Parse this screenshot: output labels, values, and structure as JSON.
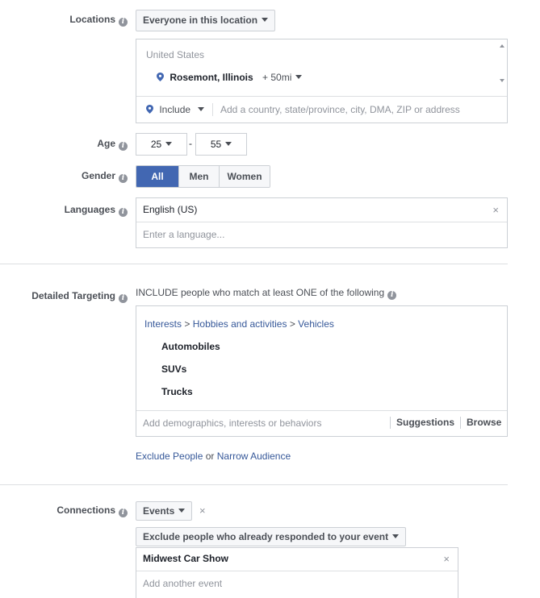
{
  "locations": {
    "label": "Locations",
    "mode_button": "Everyone in this location",
    "country": "United States",
    "city": "Rosemont, Illinois",
    "radius": "+ 50mi",
    "include_label": "Include",
    "placeholder": "Add a country, state/province, city, DMA, ZIP or address"
  },
  "age": {
    "label": "Age",
    "min": "25",
    "separator": "-",
    "max": "55"
  },
  "gender": {
    "label": "Gender",
    "options": [
      "All",
      "Men",
      "Women"
    ],
    "selected": "All"
  },
  "languages": {
    "label": "Languages",
    "selected": "English (US)",
    "placeholder": "Enter a language..."
  },
  "detailed_targeting": {
    "label": "Detailed Targeting",
    "instruction": "INCLUDE people who match at least ONE of the following",
    "breadcrumb": [
      "Interests",
      "Hobbies and activities",
      "Vehicles"
    ],
    "breadcrumb_sep": ">",
    "items": [
      "Automobiles",
      "SUVs",
      "Trucks"
    ],
    "placeholder": "Add demographics, interests or behaviors",
    "suggestions": "Suggestions",
    "browse": "Browse",
    "exclude_link": "Exclude People",
    "or_text": "or",
    "narrow_link": "Narrow Audience"
  },
  "connections": {
    "label": "Connections",
    "type_button": "Events",
    "exclude_dropdown": "Exclude people who already responded to your event",
    "event": "Midwest Car Show",
    "placeholder": "Add another event"
  },
  "icons": {
    "info": "info-icon",
    "pin": "map-pin-icon",
    "close": "close-icon",
    "caret": "caret-down-icon"
  },
  "colors": {
    "accent": "#4267b2",
    "link": "#365899",
    "border": "#ccd0d5"
  }
}
